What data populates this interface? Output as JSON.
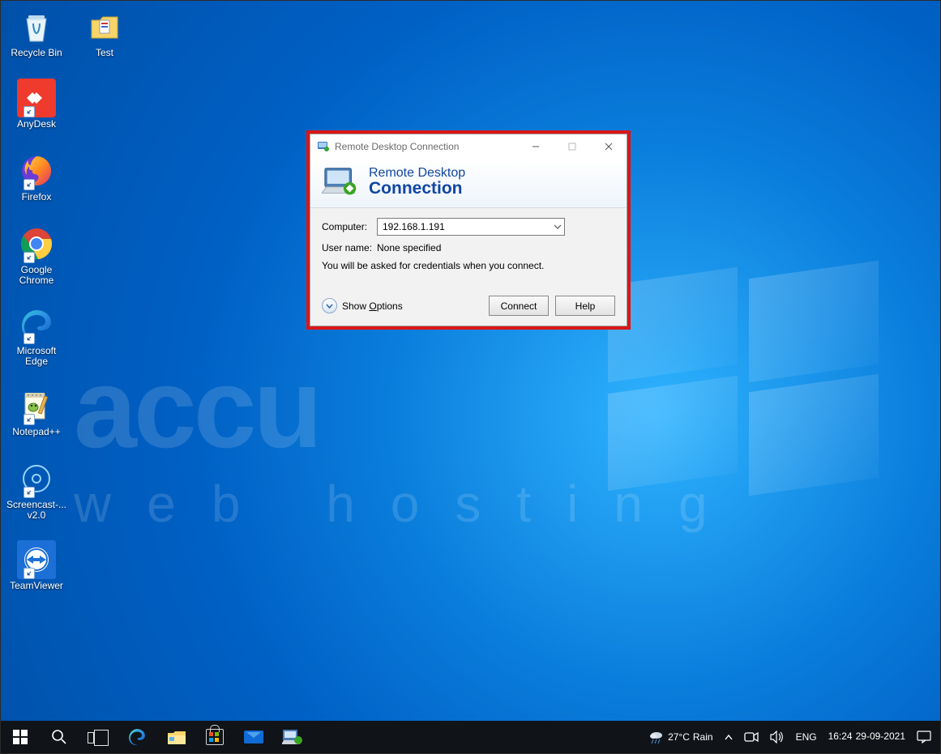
{
  "desktop_icons": {
    "recycle_bin": "Recycle Bin",
    "test": "Test",
    "anydesk": "AnyDesk",
    "firefox": "Firefox",
    "chrome": "Google Chrome",
    "edge": "Microsoft Edge",
    "notepadpp": "Notepad++",
    "screencast": "Screencast-... v2.0",
    "teamviewer": "TeamViewer"
  },
  "watermark": {
    "line1": "accu",
    "line2": "web hosting"
  },
  "rdc": {
    "window_title": "Remote Desktop Connection",
    "banner_line1": "Remote Desktop",
    "banner_line2": "Connection",
    "computer_label": "Computer:",
    "computer_value": "192.168.1.191",
    "username_label": "User name:",
    "username_value": "None specified",
    "hint": "You will be asked for credentials when you connect.",
    "show_options": "Show Options",
    "connect": "Connect",
    "help": "Help"
  },
  "taskbar": {
    "weather_temp": "27°C",
    "weather_cond": "Rain",
    "lang": "ENG",
    "time": "16:24",
    "date": "29-09-2021"
  }
}
